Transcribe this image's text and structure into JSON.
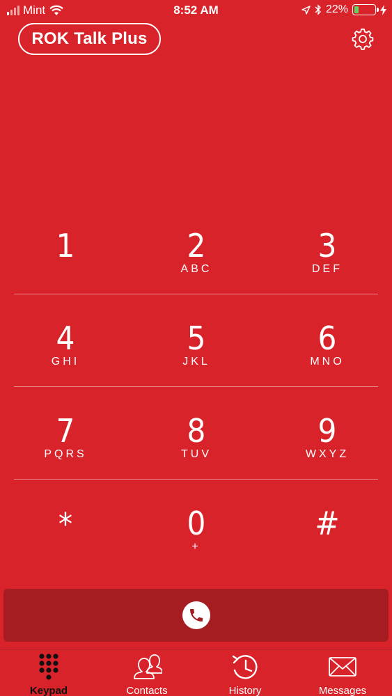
{
  "status_bar": {
    "carrier": "Mint",
    "time": "8:52 AM",
    "battery_percent": "22%",
    "battery_level": 0.22,
    "signal_bars": 1,
    "icons": [
      "wifi-icon",
      "location-icon",
      "bluetooth-icon",
      "charging-icon"
    ]
  },
  "header": {
    "app_title": "ROK Talk Plus",
    "settings_icon": "gear-icon"
  },
  "keypad": {
    "rows": [
      [
        {
          "digit": "1",
          "letters": ""
        },
        {
          "digit": "2",
          "letters": "ABC"
        },
        {
          "digit": "3",
          "letters": "DEF"
        }
      ],
      [
        {
          "digit": "4",
          "letters": "GHI"
        },
        {
          "digit": "5",
          "letters": "JKL"
        },
        {
          "digit": "6",
          "letters": "MNO"
        }
      ],
      [
        {
          "digit": "7",
          "letters": "PQRS"
        },
        {
          "digit": "8",
          "letters": "TUV"
        },
        {
          "digit": "9",
          "letters": "WXYZ"
        }
      ],
      [
        {
          "digit": "*",
          "letters": ""
        },
        {
          "digit": "0",
          "letters": "+"
        },
        {
          "digit": "#",
          "letters": ""
        }
      ]
    ]
  },
  "call_button": {
    "icon": "phone-icon"
  },
  "tab_bar": {
    "tabs": [
      {
        "label": "Keypad",
        "icon": "keypad-icon",
        "active": true
      },
      {
        "label": "Contacts",
        "icon": "contacts-icon",
        "active": false
      },
      {
        "label": "History",
        "icon": "history-icon",
        "active": false
      },
      {
        "label": "Messages",
        "icon": "envelope-icon",
        "active": false
      }
    ]
  },
  "colors": {
    "background": "#D8232A",
    "call_bar": "#A51C21",
    "text": "#FFFFFF",
    "active_tab": "#111111"
  }
}
